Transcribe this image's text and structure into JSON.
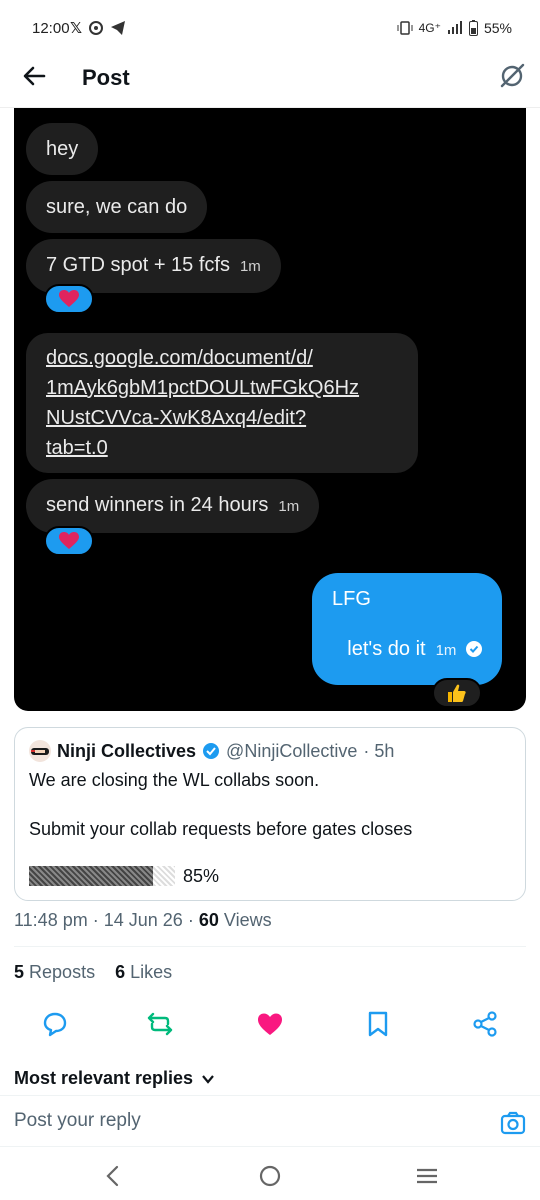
{
  "status_bar": {
    "time": "12:00",
    "network": "4G⁺",
    "battery": "55%"
  },
  "header": {
    "title": "Post"
  },
  "chat": {
    "messages": [
      {
        "text": "hey"
      },
      {
        "text": "sure, we can do"
      },
      {
        "text": "7 GTD spot + 15 fcfs",
        "time": "1m"
      },
      {
        "link_lines": [
          "docs.google.com/document/d/",
          "1mAyk6gbM1pctDOULtwFGkQ6Hz",
          "NUstCVVca-XwK8Axq4/edit?",
          "tab=t.0"
        ]
      },
      {
        "text": "send winners in 24 hours",
        "time": "1m"
      },
      {
        "line1": "LFG",
        "line2": "let's do it",
        "time": "1m"
      }
    ],
    "reactions": [
      "heart",
      "heart",
      "thumbs-up"
    ]
  },
  "quote": {
    "name": "Ninji Collectives",
    "handle": "@NinjiCollective",
    "time": "· 5h",
    "line1": "We are closing the WL collabs soon.",
    "line2": "Submit your collab requests before gates closes",
    "progress_percent": 85,
    "progress_label": "85%"
  },
  "meta": {
    "time": "11:48 pm",
    "date": "14 Jun 26",
    "views_count": "60",
    "views_label": "Views",
    "sep": "·"
  },
  "stats": {
    "reposts_count": "5",
    "reposts_label": "Reposts",
    "likes_count": "6",
    "likes_label": "Likes"
  },
  "actions": {
    "icons": [
      "reply-icon",
      "repost-icon",
      "like-icon",
      "bookmark-icon",
      "share-icon"
    ],
    "repost_color": "#00ba7c",
    "like_color": "#f91880"
  },
  "replies": {
    "sort_label": "Most relevant replies",
    "placeholder": "Post your reply"
  },
  "colors": {
    "accent": "#1d9bf0",
    "chat_bg": "#000000",
    "bubble_bg": "#1f1f1f"
  }
}
